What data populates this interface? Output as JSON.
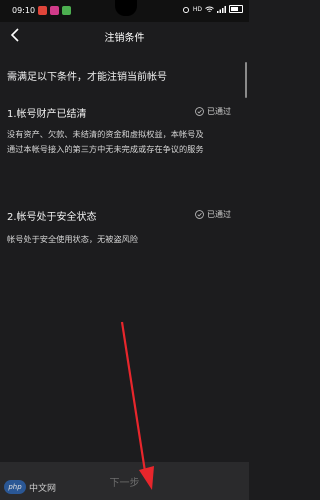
{
  "status_bar": {
    "time": "09:10",
    "network_label": "HD",
    "battery": "100"
  },
  "header": {
    "title": "注销条件",
    "back_icon": "chevron-left-icon"
  },
  "intro": "需满足以下条件，才能注销当前帐号",
  "conditions": [
    {
      "title": "1.帐号财产已结清",
      "status": "已通过",
      "description_lines": [
        "没有资产、欠款、未结清的资金和虚拟权益，本帐号及",
        "通过本帐号接入的第三方中无未完成或存在争议的服务"
      ]
    },
    {
      "title": "2.帐号处于安全状态",
      "status": "已通过",
      "description_lines": [
        "帐号处于安全使用状态，无被盗风险"
      ]
    }
  ],
  "next_button": {
    "label": "下一步"
  },
  "watermark": {
    "logo": "php",
    "text": "中文网"
  },
  "colors": {
    "background": "#1c1c1e",
    "bottom_bar": "#2a2a2c",
    "arrow": "#e8262c"
  }
}
